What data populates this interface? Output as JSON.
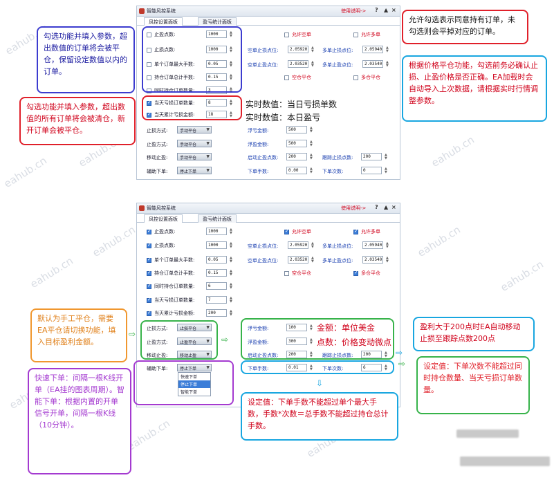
{
  "app": {
    "title": "智能风控系统",
    "help_link": "使用说明->",
    "help_btn": "?",
    "pin_btn": "▲",
    "close_btn": "×",
    "tabs": [
      "风控设置面板",
      "盈亏统计面板"
    ]
  },
  "panel1": {
    "rows": [
      {
        "label": "止盈点数:",
        "value": "1000",
        "checked": false
      },
      {
        "label": "止损点数:",
        "value": "1000",
        "checked": false
      },
      {
        "label": "单个订单最大手数:",
        "value": "0.05",
        "checked": false
      },
      {
        "label": "持仓订单总计手数:",
        "value": "0.15",
        "checked": false
      },
      {
        "label": "同时持仓订单数量:",
        "value": "3",
        "checked": false
      },
      {
        "label": "当天亏损订单数量:",
        "value": "8",
        "checked": true
      },
      {
        "label": "当天累计亏损金额:",
        "value": "18",
        "checked": true
      }
    ],
    "allow_short": "允许空单",
    "allow_long": "允许多单",
    "short_sl_label": "空单止损点位:",
    "short_sl_value": "2.05920",
    "long_sl_label": "多单止损点位:",
    "long_sl_value": "2.05940",
    "short_tp_label": "空单止盈点位:",
    "short_tp_value": "2.03520",
    "long_tp_label": "多单止盈点位:",
    "long_tp_value": "2.03540",
    "short_close": "空仓平仓",
    "long_close": "多仓平仓",
    "stop_mode_label": "止损方式:",
    "stop_mode_value": "手动平仓",
    "tp_mode_label": "止盈方式:",
    "tp_mode_value": "手动平仓",
    "move_label": "移动止盈:",
    "move_value": "手动平仓",
    "assist_label": "辅助下单:",
    "assist_value": "停止下单",
    "float_loss_label": "浮亏金额:",
    "float_loss_value": "500",
    "float_profit_label": "浮盈金额:",
    "float_profit_value": "500",
    "start_sl_label": "启动止盈点数:",
    "start_sl_value": "200",
    "trail_label": "跟踪止损点数:",
    "trail_value": "200",
    "lot_label": "下单手数:",
    "lot_value": "0.00",
    "times_label": "下单次数:",
    "times_value": "0"
  },
  "panel2": {
    "rows": [
      {
        "label": "止盈点数:",
        "value": "1000"
      },
      {
        "label": "止损点数:",
        "value": "1000"
      },
      {
        "label": "单个订单最大手数:",
        "value": "0.05"
      },
      {
        "label": "持仓订单总计手数:",
        "value": "0.15"
      },
      {
        "label": "同时持仓订单数量:",
        "value": "6"
      },
      {
        "label": "当天亏损订单数量:",
        "value": "7"
      },
      {
        "label": "当天累计亏损金额:",
        "value": "200"
      }
    ],
    "allow_short": "允许空单",
    "allow_long": "允许多单",
    "short_sl_value": "2.05920",
    "long_sl_value": "2.05940",
    "short_tp_value": "2.03520",
    "long_tp_value": "2.03540",
    "short_close": "空仓平仓",
    "long_close": "多仓平仓",
    "stop_mode_value": "止损平仓",
    "tp_mode_value": "止盈平仓",
    "move_value": "移动止盈",
    "assist_value": "停止下单",
    "assist_options": [
      "快速下单",
      "停止下单",
      "智能下单"
    ],
    "float_loss_value": "100",
    "float_profit_value": "300",
    "start_sl_value": "200",
    "trail_value": "200",
    "lot_value": "0.01",
    "times_value": "6"
  },
  "notes": {
    "n1": "勾选功能并填入参数，超出数值的订单将会被平仓，保留设定数值以内的订单。",
    "n2": "勾选功能并填入参数，超出数值的所有订单将会被清仓，新开订单会被平仓。",
    "n3": "允许勾选表示同意持有订单，未勾选则会平掉对应的订单。",
    "n4": "根据价格平仓功能，勾选前务必确认止损、止盈价格是否正确。EA加载时会自动导入上次数据，请根据实时行情调整参数。",
    "n5a": "实时数值：当日亏损单数",
    "n5b": "实时数值：本日盈亏",
    "n6": "默认为手工平仓，需要EA平仓请切换功能，填入目标盈利金额。",
    "n7": "快速下单：间隔一根K线开单（EA挂的图表周期）。智能下单：根据内置的开单信号开单，间隔一根K线（10分钟）。",
    "n8a": "金额：单位美金",
    "n8b": "点数：价格变动微点",
    "n9": "盈利大于200点时EA自动移动止损至跟踪点数200点",
    "n10": "设定值：下单次数不能超过同时持仓数量、当天亏损订单数量。",
    "n11": "设定值：下单手数不能超过单个最大手数，手数*次数＝总手数不能超过持仓总计手数。"
  },
  "watermark": "eahub.cn"
}
